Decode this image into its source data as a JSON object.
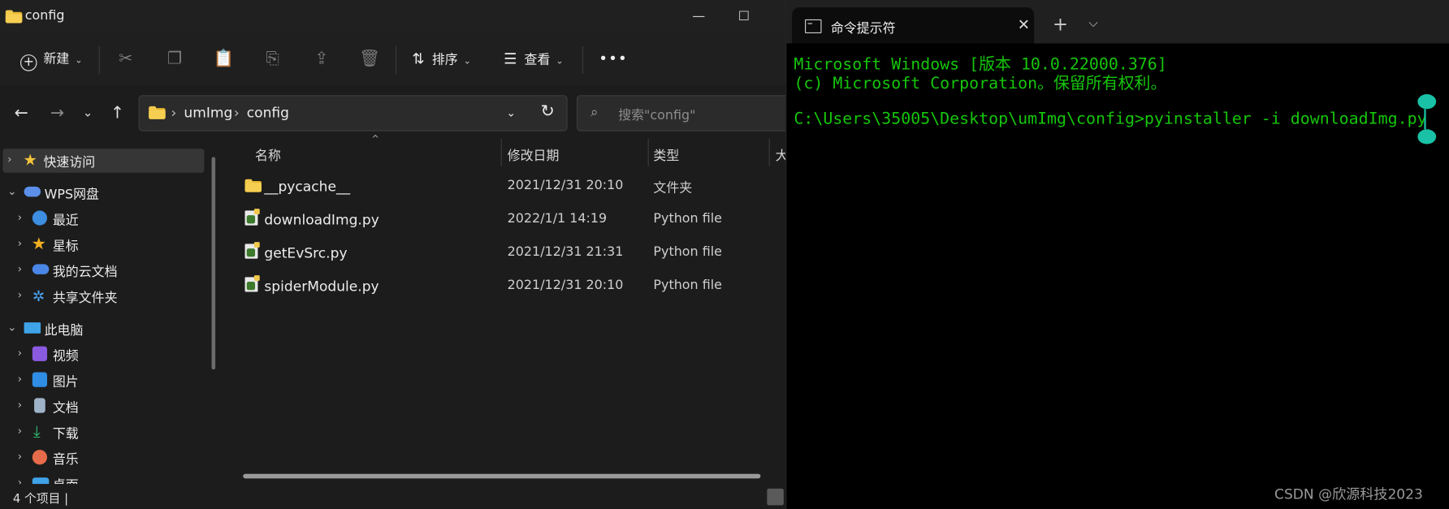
{
  "explorer": {
    "title": "config",
    "window_buttons": {
      "minimize": "—",
      "maximize": "☐"
    },
    "toolbar": {
      "new_label": "新建",
      "sort_label": "排序",
      "view_label": "查看",
      "more_label": "•••"
    },
    "address": {
      "crumbs": [
        "umImg",
        "config"
      ],
      "search_placeholder": "搜索\"config\""
    },
    "nav": {
      "items": [
        {
          "label": "快速访问"
        },
        {
          "label": "WPS网盘"
        },
        {
          "label": "最近"
        },
        {
          "label": "星标"
        },
        {
          "label": "我的云文档"
        },
        {
          "label": "共享文件夹"
        },
        {
          "label": "此电脑"
        },
        {
          "label": "视频"
        },
        {
          "label": "图片"
        },
        {
          "label": "文档"
        },
        {
          "label": "下载"
        },
        {
          "label": "音乐"
        },
        {
          "label": "桌面"
        }
      ]
    },
    "columns": {
      "name": "名称",
      "date": "修改日期",
      "type": "类型",
      "size": "大"
    },
    "files": [
      {
        "name": "__pycache__",
        "date": "2021/12/31 20:10",
        "type": "文件夹"
      },
      {
        "name": "downloadImg.py",
        "date": "2022/1/1 14:19",
        "type": "Python file"
      },
      {
        "name": "getEvSrc.py",
        "date": "2021/12/31 21:31",
        "type": "Python file"
      },
      {
        "name": "spiderModule.py",
        "date": "2021/12/31 20:10",
        "type": "Python file"
      }
    ],
    "status": "4 个项目  |"
  },
  "terminal": {
    "tab_title": "命令提示符",
    "lines": [
      "Microsoft Windows [版本 10.0.22000.376]",
      "(c) Microsoft Corporation。保留所有权利。",
      "",
      "C:\\Users\\35005\\Desktop\\umImg\\config>pyinstaller -i downloadImg.py"
    ],
    "text_color": "#16C60C"
  },
  "watermark": "CSDN @欣源科技2023"
}
